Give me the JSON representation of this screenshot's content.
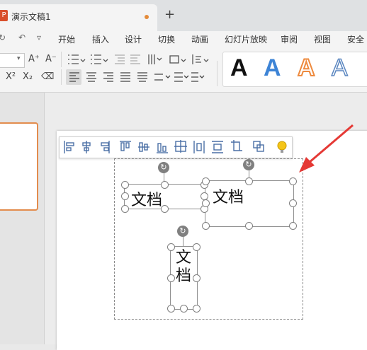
{
  "document": {
    "title": "演示文稿1",
    "new_tab": "+"
  },
  "menu": {
    "icons": [
      "↻",
      "↶",
      "▿"
    ],
    "items": [
      "开始",
      "插入",
      "设计",
      "切换",
      "动画",
      "幻灯片放映",
      "审阅",
      "视图",
      "安全"
    ]
  },
  "ribbon": {
    "font_grow": "A⁺",
    "font_shrink": "A⁻",
    "superscript": "X²",
    "subscript": "X₂",
    "clear_format": "⌫",
    "style_letter": "A"
  },
  "float_toolbar": {
    "icons": [
      "▐≡",
      "═╪",
      "≡▌",
      "▀║",
      "╫",
      "▄║",
      "┼",
      "║║║",
      "══",
      "┐",
      "▣",
      "●"
    ]
  },
  "textboxes": [
    {
      "text": "文档"
    },
    {
      "text": "文档"
    },
    {
      "text": "文档"
    }
  ],
  "colors": {
    "accent": "#e48b3a",
    "arrow": "#e53935",
    "style_blue": "#3d84d6",
    "style_orange": "#ee8a3e"
  }
}
